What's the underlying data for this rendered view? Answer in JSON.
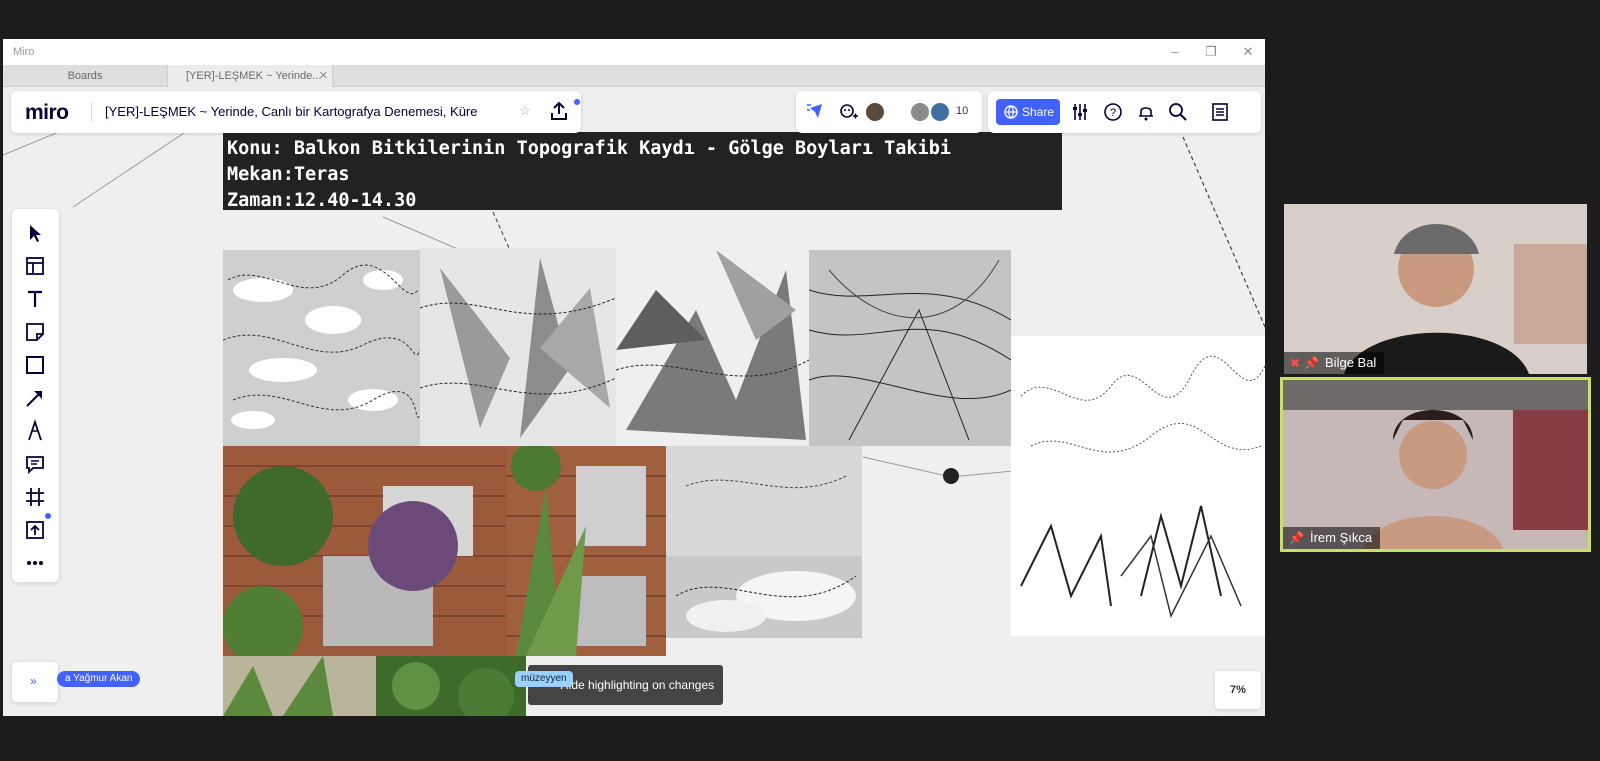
{
  "window": {
    "app_title": "Miro",
    "tabs": [
      "Boards",
      "[YER]-LEŞMEK ~ Yerinde..."
    ]
  },
  "board": {
    "logo": "miro",
    "title": "[YER]-LEŞMEK ~ Yerinde, Canlı bir Kartografya Denemesi, Küre",
    "collaborator_count": "10",
    "share_label": "Share"
  },
  "heading": {
    "line1": "Konu: Balkon Bitkilerinin Topografik Kaydı - Gölge Boyları Takibi",
    "line2": "Mekan:Teras",
    "line3": "Zaman:12.40-14.30"
  },
  "toolbar": {
    "tools": [
      "select-tool",
      "templates-tool",
      "text-tool",
      "sticky-note-tool",
      "shape-tool",
      "connection-line-tool",
      "pen-tool",
      "comment-tool",
      "frame-tool",
      "upload-tool",
      "more-tool"
    ]
  },
  "canvas": {
    "cursor_user": "a Yağmur Akan",
    "cursor_user2": "müzeyyen",
    "tooltip": "Hide highlighting on changes",
    "zoom": "7%"
  },
  "participants": [
    {
      "name": "Bilge Bal",
      "muted": true
    },
    {
      "name": "İrem Şıkca",
      "muted": false
    }
  ],
  "colors": {
    "accent": "#4262ff",
    "active_speaker": "#c8e25b",
    "heading_bg": "#222222"
  }
}
